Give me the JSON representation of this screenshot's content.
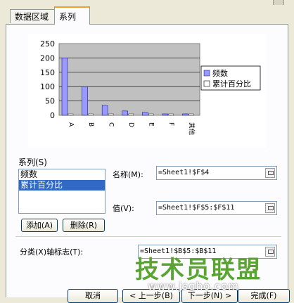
{
  "tabs": [
    {
      "label": "数据区域"
    },
    {
      "label": "系列"
    }
  ],
  "chart_data": {
    "type": "bar",
    "categories": [
      "A",
      "B",
      "C",
      "D",
      "E",
      "F",
      "其他"
    ],
    "series": [
      {
        "name": "频数",
        "values": [
          200,
          100,
          35,
          15,
          10,
          5,
          5
        ]
      },
      {
        "name": "累计百分比",
        "values": [
          0.45,
          0.7,
          0.8,
          0.87,
          0.92,
          0.96,
          1.0
        ]
      }
    ],
    "yticks": [
      "250",
      "200",
      "150",
      "100",
      "50",
      "0"
    ],
    "ylim": [
      0,
      250
    ],
    "grid": true,
    "legend": "right",
    "colors": {
      "series1": "#9999ff",
      "series2": "#ffffff",
      "plot_bg": "#c0c0c0"
    }
  },
  "series_panel": {
    "label": "系列(S)",
    "items": [
      {
        "label": "频数",
        "selected": false
      },
      {
        "label": "累计百分比",
        "selected": true
      }
    ],
    "add_label": "添加(A)",
    "delete_label": "删除(R)"
  },
  "fields": {
    "name_label": "名称(M):",
    "name_value": "=Sheet1!$F$4",
    "value_label": "值(V):",
    "value_value": "=Sheet1!$F$5:$F$11",
    "axis_label": "分类(X)轴标志(T):",
    "axis_value": "=Sheet1!$B$5:$B$11"
  },
  "buttons": {
    "cancel": "取消",
    "back": "< 上一步(B)",
    "next": "下一步(N) >",
    "finish": "完成(F)"
  },
  "watermark": {
    "logo": "技术员联盟",
    "site": "www.jsgho.com"
  }
}
